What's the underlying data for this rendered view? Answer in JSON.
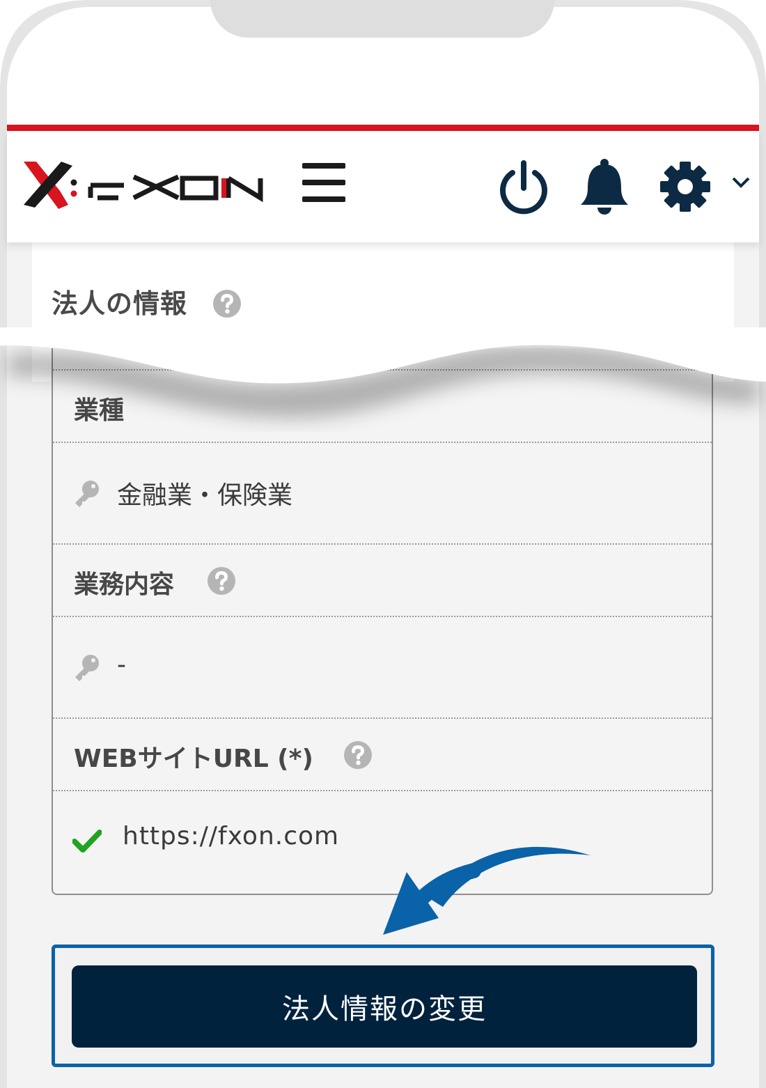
{
  "header": {
    "logo_text": "FXON",
    "icons": {
      "menu": "hamburger-menu-icon",
      "power": "power-icon",
      "notifications": "bell-icon",
      "settings": "gear-icon",
      "settings_dropdown": "chevron-down-icon"
    }
  },
  "section": {
    "title": "法人の情報",
    "help_icon": "question-circle-icon"
  },
  "fields": [
    {
      "label": "業種",
      "value": "金融業・保険業",
      "status_icon": "key-icon",
      "has_help": false
    },
    {
      "label": "業務内容",
      "value": "-",
      "status_icon": "key-icon",
      "has_help": true
    },
    {
      "label": "WEBサイトURL (*)",
      "value": "https://fxon.com",
      "status_icon": "check-icon",
      "has_help": true
    }
  ],
  "submit_button": {
    "label": "法人情報の変更"
  },
  "colors": {
    "brand_red": "#d8141f",
    "navy": "#00223d",
    "highlight_blue": "#0a62a8",
    "check_green": "#21a321",
    "icon_gray": "#b5b5b5"
  }
}
